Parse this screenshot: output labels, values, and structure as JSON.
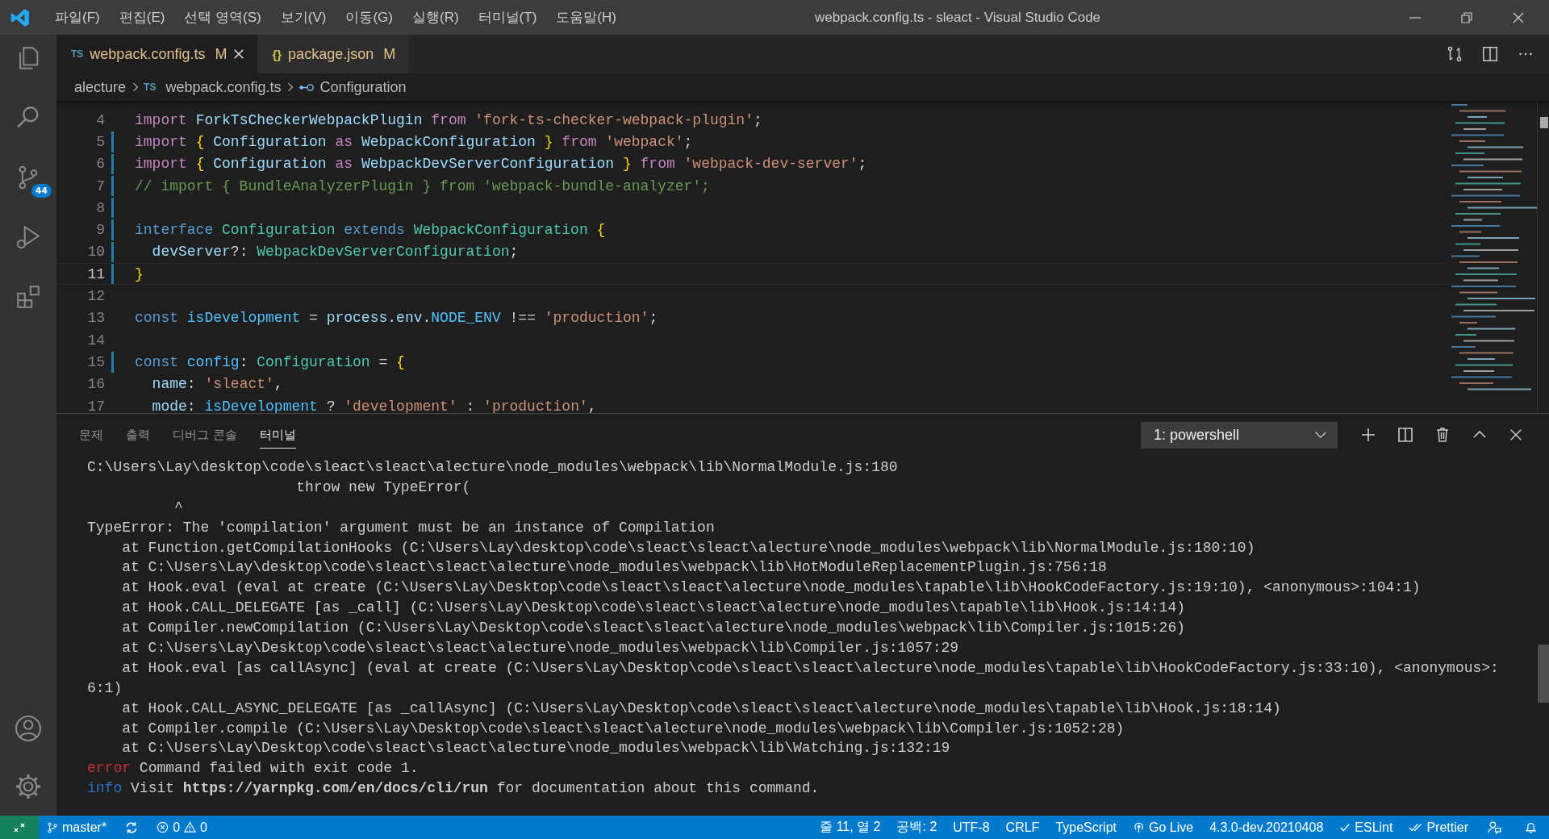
{
  "window": {
    "title": "webpack.config.ts - sleact - Visual Studio Code"
  },
  "menu": [
    "파일(F)",
    "편집(E)",
    "선택 영역(S)",
    "보기(V)",
    "이동(G)",
    "실행(R)",
    "터미널(T)",
    "도움말(H)"
  ],
  "activity_bar": {
    "source_control_badge": "44"
  },
  "tabs": [
    {
      "icon": "TS",
      "kind": "ts",
      "label": "webpack.config.ts",
      "status": "M",
      "selected": true
    },
    {
      "icon": "{}",
      "kind": "json",
      "label": "package.json",
      "status": "M",
      "selected": false
    }
  ],
  "breadcrumb": [
    {
      "label": "alecture",
      "kind": "folder"
    },
    {
      "label": "webpack.config.ts",
      "kind": "file",
      "icon": "TS"
    },
    {
      "label": "Configuration",
      "kind": "symbol"
    }
  ],
  "code": [
    {
      "number": "4",
      "current": false,
      "modified": false,
      "tokens": [
        {
          "kind": "kw",
          "text": "import "
        },
        {
          "kind": "var",
          "text": "ForkTsCheckerWebpackPlugin "
        },
        {
          "kind": "kw",
          "text": "from "
        },
        {
          "kind": "str",
          "text": "'fork-ts-checker-webpack-plugin'"
        },
        {
          "kind": "plain",
          "text": ";"
        }
      ]
    },
    {
      "number": "5",
      "current": false,
      "modified": true,
      "tokens": [
        {
          "kind": "kw",
          "text": "import "
        },
        {
          "kind": "brace",
          "text": "{ "
        },
        {
          "kind": "var",
          "text": "Configuration "
        },
        {
          "kind": "kw",
          "text": "as "
        },
        {
          "kind": "var",
          "text": "WebpackConfiguration "
        },
        {
          "kind": "brace",
          "text": "} "
        },
        {
          "kind": "kw",
          "text": "from "
        },
        {
          "kind": "str",
          "text": "'webpack'"
        },
        {
          "kind": "plain",
          "text": ";"
        }
      ]
    },
    {
      "number": "6",
      "current": false,
      "modified": true,
      "tokens": [
        {
          "kind": "kw",
          "text": "import "
        },
        {
          "kind": "brace",
          "text": "{ "
        },
        {
          "kind": "var",
          "text": "Configuration "
        },
        {
          "kind": "kw",
          "text": "as "
        },
        {
          "kind": "var",
          "text": "WebpackDevServerConfiguration "
        },
        {
          "kind": "brace",
          "text": "} "
        },
        {
          "kind": "kw",
          "text": "from "
        },
        {
          "kind": "str",
          "text": "'webpack-dev-server'"
        },
        {
          "kind": "plain",
          "text": ";"
        }
      ]
    },
    {
      "number": "7",
      "current": false,
      "modified": true,
      "tokens": [
        {
          "kind": "cmt",
          "text": "// import { BundleAnalyzerPlugin } from 'webpack-bundle-analyzer';"
        }
      ]
    },
    {
      "number": "8",
      "current": false,
      "modified": true
    },
    {
      "number": "9",
      "current": false,
      "modified": true,
      "tokens": [
        {
          "kind": "storage",
          "text": "interface "
        },
        {
          "kind": "type",
          "text": "Configuration "
        },
        {
          "kind": "storage",
          "text": "extends "
        },
        {
          "kind": "type",
          "text": "WebpackConfiguration "
        },
        {
          "kind": "brace",
          "text": "{"
        }
      ]
    },
    {
      "number": "10",
      "current": false,
      "modified": true,
      "tokens": [
        {
          "kind": "var",
          "text": "  devServer"
        },
        {
          "kind": "plain",
          "text": "?: "
        },
        {
          "kind": "type",
          "text": "WebpackDevServerConfiguration"
        },
        {
          "kind": "plain",
          "text": ";"
        }
      ]
    },
    {
      "number": "11",
      "current": true,
      "modified": true,
      "tokens": [
        {
          "kind": "brace",
          "text": "}"
        }
      ]
    },
    {
      "number": "12",
      "current": false,
      "modified": false
    },
    {
      "number": "13",
      "current": false,
      "modified": false,
      "tokens": [
        {
          "kind": "storage",
          "text": "const "
        },
        {
          "kind": "const",
          "text": "isDevelopment "
        },
        {
          "kind": "plain",
          "text": "= "
        },
        {
          "kind": "var",
          "text": "process"
        },
        {
          "kind": "plain",
          "text": "."
        },
        {
          "kind": "var",
          "text": "env"
        },
        {
          "kind": "plain",
          "text": "."
        },
        {
          "kind": "const",
          "text": "NODE_ENV "
        },
        {
          "kind": "plain",
          "text": "!== "
        },
        {
          "kind": "str",
          "text": "'production'"
        },
        {
          "kind": "plain",
          "text": ";"
        }
      ]
    },
    {
      "number": "14",
      "current": false,
      "modified": false
    },
    {
      "number": "15",
      "current": false,
      "modified": true,
      "tokens": [
        {
          "kind": "storage",
          "text": "const "
        },
        {
          "kind": "const",
          "text": "config"
        },
        {
          "kind": "plain",
          "text": ": "
        },
        {
          "kind": "type",
          "text": "Configuration "
        },
        {
          "kind": "plain",
          "text": "= "
        },
        {
          "kind": "brace",
          "text": "{"
        }
      ]
    },
    {
      "number": "16",
      "current": false,
      "modified": false,
      "tokens": [
        {
          "kind": "var",
          "text": "  name"
        },
        {
          "kind": "plain",
          "text": ": "
        },
        {
          "kind": "str",
          "text": "'sleact'"
        },
        {
          "kind": "plain",
          "text": ","
        }
      ]
    },
    {
      "number": "17",
      "current": false,
      "modified": false,
      "tokens": [
        {
          "kind": "var",
          "text": "  mode"
        },
        {
          "kind": "plain",
          "text": ": "
        },
        {
          "kind": "const",
          "text": "isDevelopment "
        },
        {
          "kind": "plain",
          "text": "? "
        },
        {
          "kind": "str",
          "text": "'development' "
        },
        {
          "kind": "plain",
          "text": ": "
        },
        {
          "kind": "str",
          "text": "'production'"
        },
        {
          "kind": "plain",
          "text": ","
        }
      ]
    }
  ],
  "panel": {
    "tabs": [
      {
        "label": "문제",
        "selected": false
      },
      {
        "label": "출력",
        "selected": false
      },
      {
        "label": "디버그 콘솔",
        "selected": false
      },
      {
        "label": "터미널",
        "selected": true
      }
    ],
    "terminal_select": "1: powershell",
    "terminal": [
      {
        "kind": "plain",
        "text": "C:\\Users\\Lay\\desktop\\code\\sleact\\sleact\\alecture\\node_modules\\webpack\\lib\\NormalModule.js:180"
      },
      {
        "kind": "plain",
        "text": "                        throw new TypeError("
      },
      {
        "kind": "plain",
        "text": "          ^"
      },
      {
        "kind": "plain",
        "text": "TypeError: The 'compilation' argument must be an instance of Compilation"
      },
      {
        "kind": "plain",
        "text": "    at Function.getCompilationHooks (C:\\Users\\Lay\\desktop\\code\\sleact\\sleact\\alecture\\node_modules\\webpack\\lib\\NormalModule.js:180:10)"
      },
      {
        "kind": "plain",
        "text": "    at C:\\Users\\Lay\\desktop\\code\\sleact\\sleact\\alecture\\node_modules\\webpack\\lib\\HotModuleReplacementPlugin.js:756:18"
      },
      {
        "kind": "plain",
        "text": "    at Hook.eval (eval at create (C:\\Users\\Lay\\Desktop\\code\\sleact\\sleact\\alecture\\node_modules\\tapable\\lib\\HookCodeFactory.js:19:10), <anonymous>:104:1)"
      },
      {
        "kind": "plain",
        "text": "    at Hook.CALL_DELEGATE [as _call] (C:\\Users\\Lay\\Desktop\\code\\sleact\\sleact\\alecture\\node_modules\\tapable\\lib\\Hook.js:14:14)"
      },
      {
        "kind": "plain",
        "text": "    at Compiler.newCompilation (C:\\Users\\Lay\\Desktop\\code\\sleact\\sleact\\alecture\\node_modules\\webpack\\lib\\Compiler.js:1015:26)"
      },
      {
        "kind": "plain",
        "text": "    at C:\\Users\\Lay\\Desktop\\code\\sleact\\sleact\\alecture\\node_modules\\webpack\\lib\\Compiler.js:1057:29"
      },
      {
        "kind": "plain",
        "text": "    at Hook.eval [as callAsync] (eval at create (C:\\Users\\Lay\\Desktop\\code\\sleact\\sleact\\alecture\\node_modules\\tapable\\lib\\HookCodeFactory.js:33:10), <anonymous>:"
      },
      {
        "kind": "plain",
        "text": "6:1)"
      },
      {
        "kind": "plain",
        "text": "    at Hook.CALL_ASYNC_DELEGATE [as _callAsync] (C:\\Users\\Lay\\Desktop\\code\\sleact\\sleact\\alecture\\node_modules\\tapable\\lib\\Hook.js:18:14)"
      },
      {
        "kind": "plain",
        "text": "    at Compiler.compile (C:\\Users\\Lay\\Desktop\\code\\sleact\\sleact\\alecture\\node_modules\\webpack\\lib\\Compiler.js:1052:28)"
      },
      {
        "kind": "plain",
        "text": "    at C:\\Users\\Lay\\Desktop\\code\\sleact\\sleact\\alecture\\node_modules\\webpack\\lib\\Watching.js:132:19"
      },
      {
        "kind": "error",
        "tag": "error",
        "text": "Command failed with exit code 1."
      },
      {
        "kind": "info",
        "tag": "info",
        "text": "Visit **https://yarnpkg.com/en/docs/cli/run** for documentation about this command."
      }
    ]
  },
  "status_bar": {
    "branch": "master*",
    "errors": "0",
    "warnings": "0",
    "right": [
      {
        "kind": "text",
        "text": "줄 11, 열 2"
      },
      {
        "kind": "text",
        "text": "공백: 2"
      },
      {
        "kind": "text",
        "text": "UTF-8"
      },
      {
        "kind": "text",
        "text": "CRLF"
      },
      {
        "kind": "text",
        "text": "TypeScript"
      },
      {
        "kind": "golive",
        "text": "Go Live"
      },
      {
        "kind": "text",
        "text": "4.3.0-dev.20210408"
      },
      {
        "kind": "check",
        "text": "ESLint"
      },
      {
        "kind": "doublecheck",
        "text": "Prettier"
      }
    ]
  }
}
